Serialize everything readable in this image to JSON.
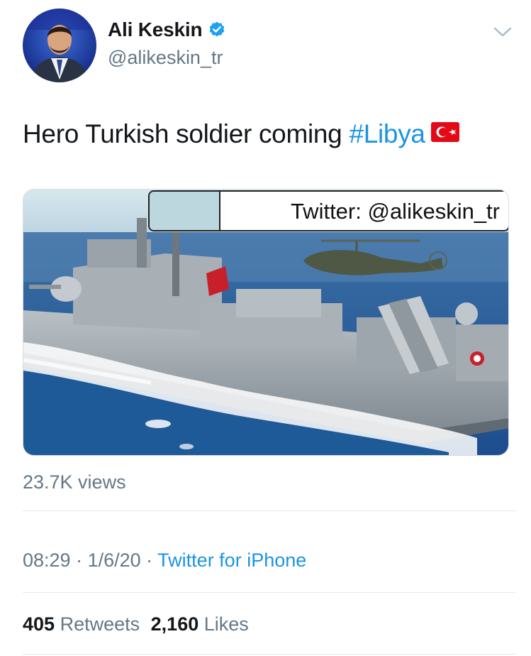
{
  "author": {
    "display_name": "Ali Keskin",
    "handle": "@alikeskin_tr",
    "verified_icon": "verified-badge-icon",
    "avatar": "avatar-photo"
  },
  "tweet": {
    "text": "Hero Turkish soldier coming ",
    "hashtag": "#Libya",
    "emoji": "turkey-flag-icon"
  },
  "media": {
    "type": "video",
    "watermark": "Twitter: @alikeskin_tr"
  },
  "views": "23.7K views",
  "meta": {
    "time": "08:29",
    "sep1": " · ",
    "date": "1/6/20",
    "sep2": " · ",
    "source": "Twitter for iPhone"
  },
  "stats": {
    "retweets_count": "405",
    "retweets_label": "Retweets",
    "likes_count": "2,160",
    "likes_label": "Likes"
  },
  "colors": {
    "link": "#1b95e0",
    "secondary_text": "#657786",
    "primary_text": "#14171a",
    "divider": "#e1e8ed"
  }
}
